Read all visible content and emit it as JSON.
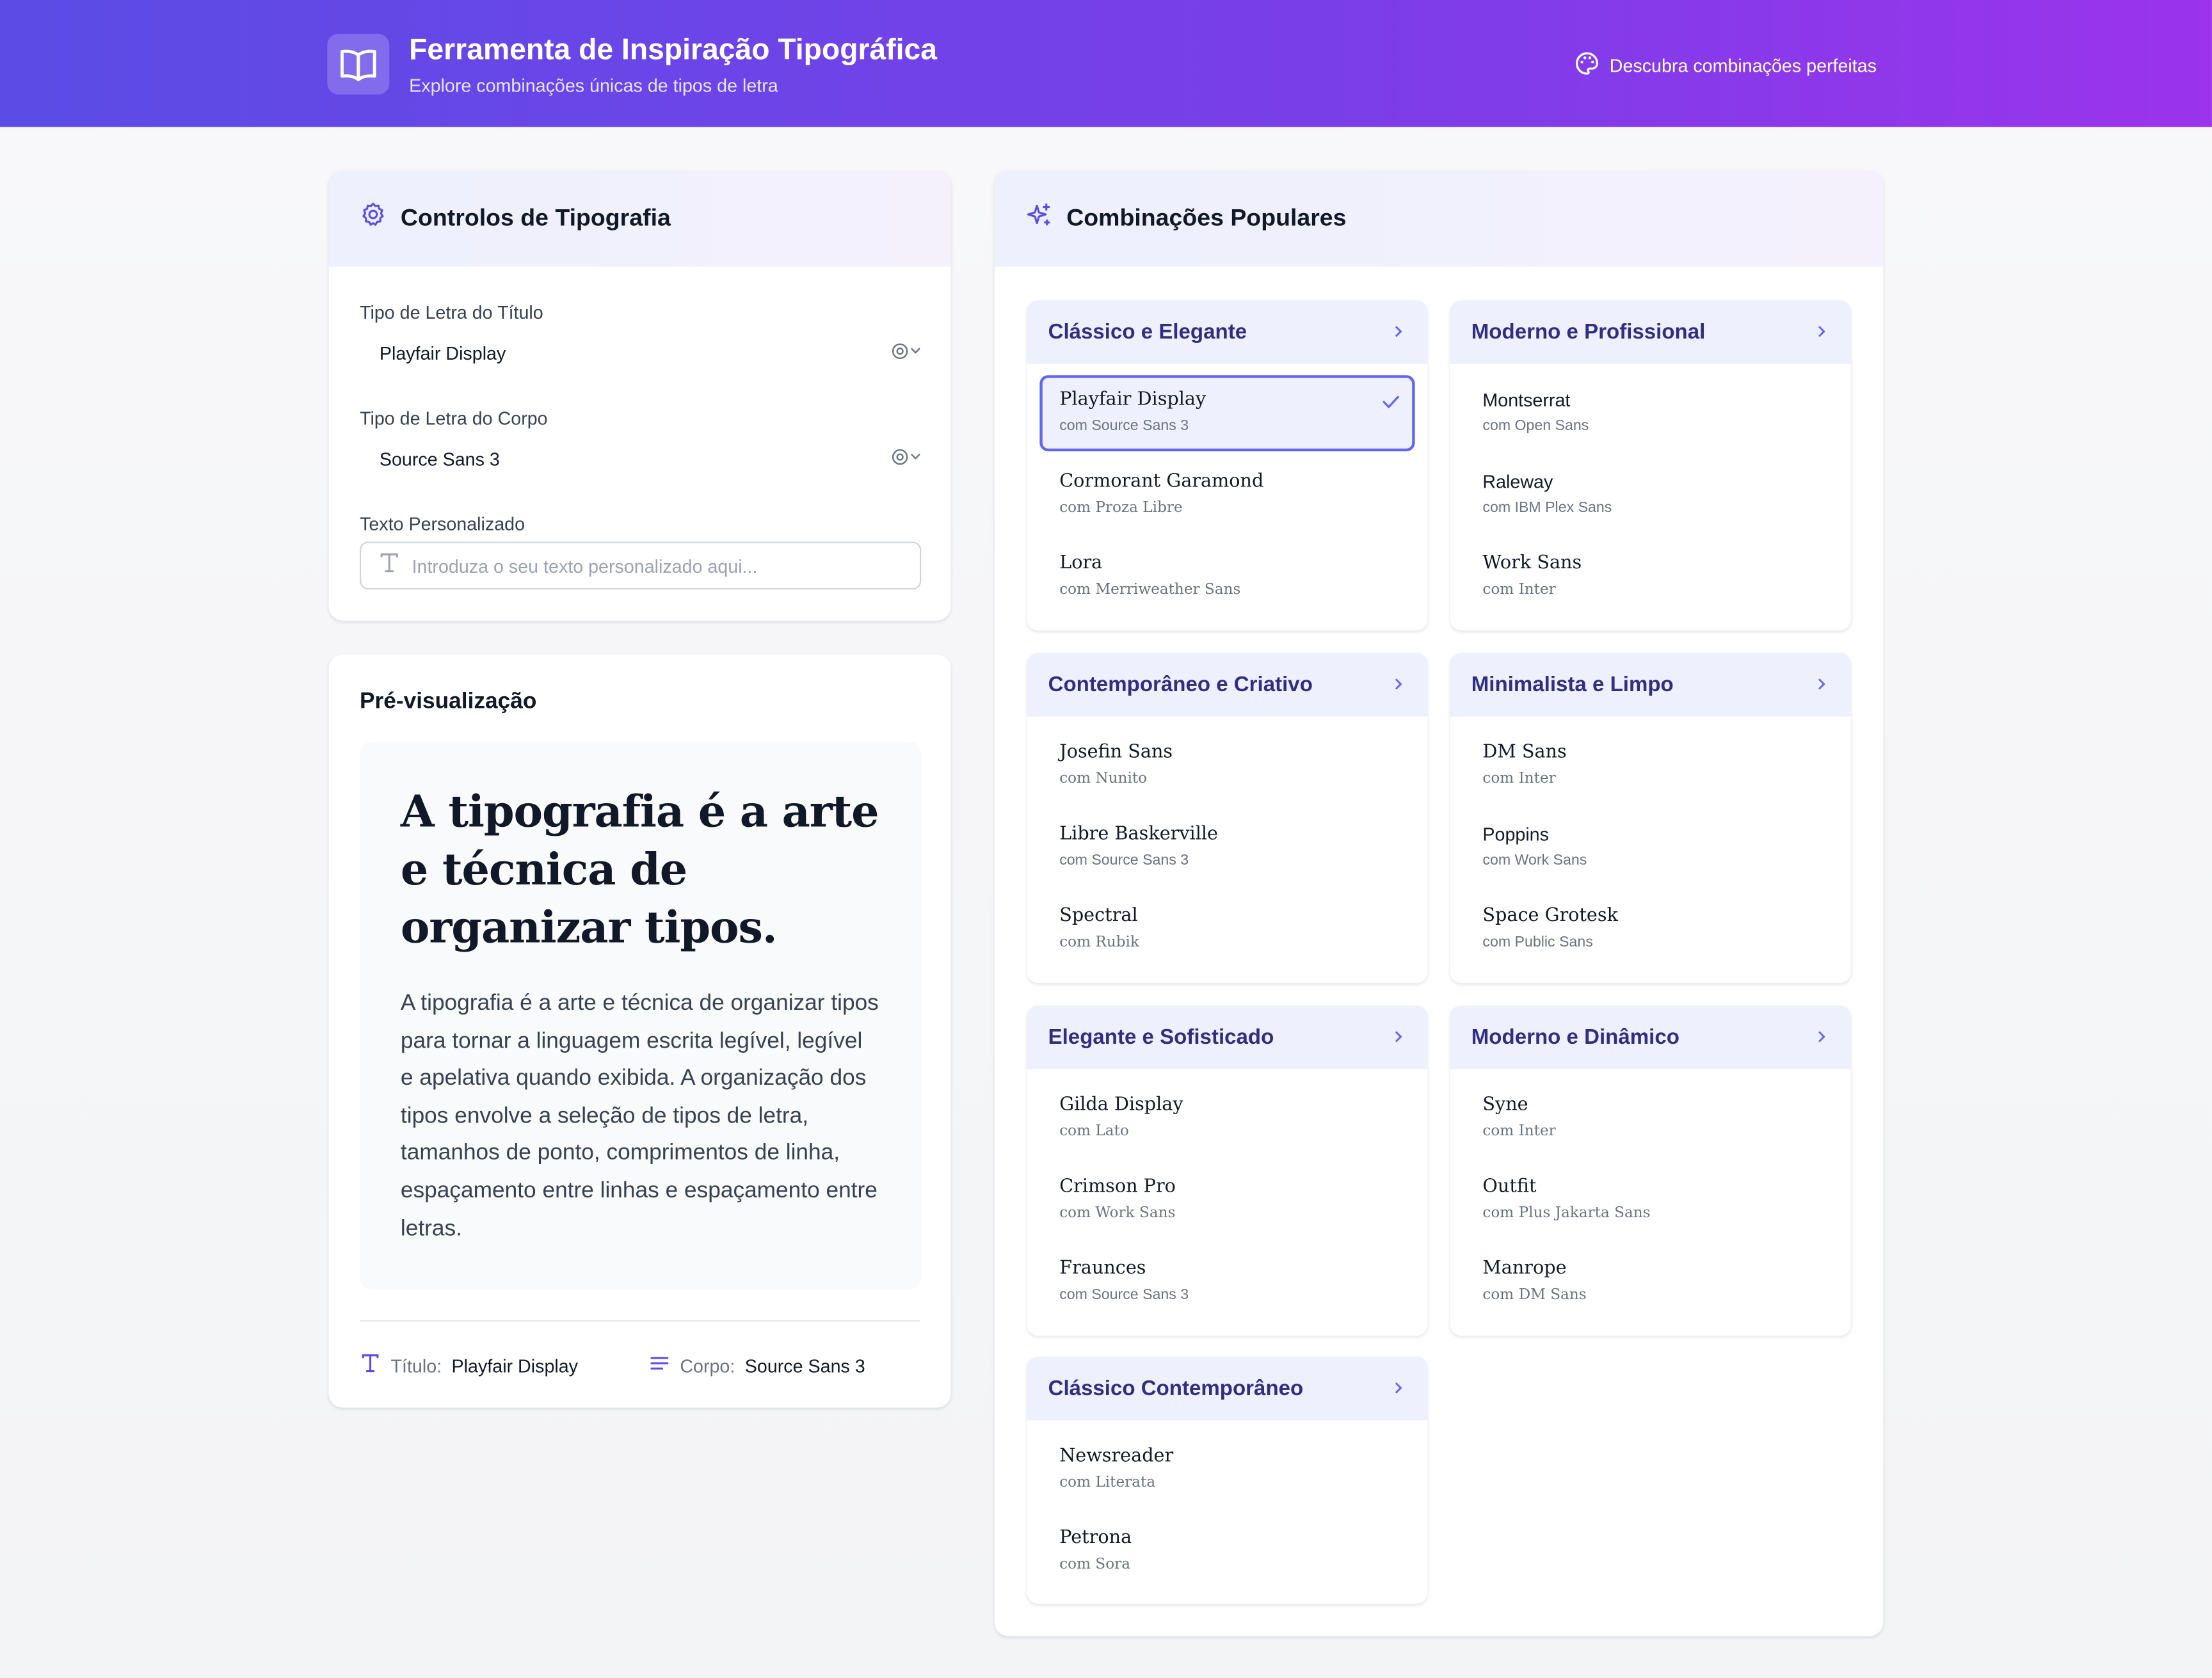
{
  "header": {
    "title": "Ferramenta de Inspiração Tipográfica",
    "subtitle": "Explore combinações únicas de tipos de letra",
    "tagline": "Descubra combinações perfeitas",
    "gradient": [
      "#5b4ce6",
      "#9b34ec"
    ]
  },
  "controls": {
    "title": "Controlos de Tipografia",
    "heading_font_label": "Tipo de Letra do Título",
    "heading_font_value": "Playfair Display",
    "body_font_label": "Tipo de Letra do Corpo",
    "body_font_value": "Source Sans 3",
    "custom_text_label": "Texto Personalizado",
    "custom_text_placeholder": "Introduza o seu texto personalizado aqui...",
    "custom_text_value": ""
  },
  "preview": {
    "title": "Pré-visualização",
    "heading": "A tipografia é a arte e técnica de organizar tipos.",
    "body": "A tipografia é a arte e técnica de organizar tipos para tornar a linguagem escrita legível, legível e apelativa quando exibida. A organização dos tipos envolve a seleção de tipos de letra, tamanhos de ponto, comprimentos de linha, espaçamento entre linhas e espaçamento entre letras.",
    "footer_heading_label": "Título:",
    "footer_heading_value": "Playfair Display",
    "footer_body_label": "Corpo:",
    "footer_body_value": "Source Sans 3"
  },
  "popular": {
    "title": "Combinações Populares",
    "accent": "#6366f1",
    "categories": [
      {
        "name": "Clássico e Elegante",
        "pairs": [
          {
            "heading": "Playfair Display",
            "body": "com Source Sans 3",
            "selected": true
          },
          {
            "heading": "Cormorant Garamond",
            "body": "com Proza Libre"
          },
          {
            "heading": "Lora",
            "body": "com Merriweather Sans"
          }
        ]
      },
      {
        "name": "Moderno e Profissional",
        "pairs": [
          {
            "heading": "Montserrat",
            "body": "com Open Sans"
          },
          {
            "heading": "Raleway",
            "body": "com IBM Plex Sans"
          },
          {
            "heading": "Work Sans",
            "body": "com Inter"
          }
        ]
      },
      {
        "name": "Contemporâneo e Criativo",
        "pairs": [
          {
            "heading": "Josefin Sans",
            "body": "com Nunito"
          },
          {
            "heading": "Libre Baskerville",
            "body": "com Source Sans 3"
          },
          {
            "heading": "Spectral",
            "body": "com Rubik"
          }
        ]
      },
      {
        "name": "Minimalista e Limpo",
        "pairs": [
          {
            "heading": "DM Sans",
            "body": "com Inter"
          },
          {
            "heading": "Poppins",
            "body": "com Work Sans"
          },
          {
            "heading": "Space Grotesk",
            "body": "com Public Sans"
          }
        ]
      },
      {
        "name": "Elegante e Sofisticado",
        "pairs": [
          {
            "heading": "Gilda Display",
            "body": "com Lato"
          },
          {
            "heading": "Crimson Pro",
            "body": "com Work Sans"
          },
          {
            "heading": "Fraunces",
            "body": "com Source Sans 3"
          }
        ]
      },
      {
        "name": "Moderno e Dinâmico",
        "pairs": [
          {
            "heading": "Syne",
            "body": "com Inter"
          },
          {
            "heading": "Outfit",
            "body": "com Plus Jakarta Sans"
          },
          {
            "heading": "Manrope",
            "body": "com DM Sans"
          }
        ]
      },
      {
        "name": "Clássico Contemporâneo",
        "pairs": [
          {
            "heading": "Newsreader",
            "body": "com Literata"
          },
          {
            "heading": "Petrona",
            "body": "com Sora"
          }
        ]
      }
    ]
  }
}
